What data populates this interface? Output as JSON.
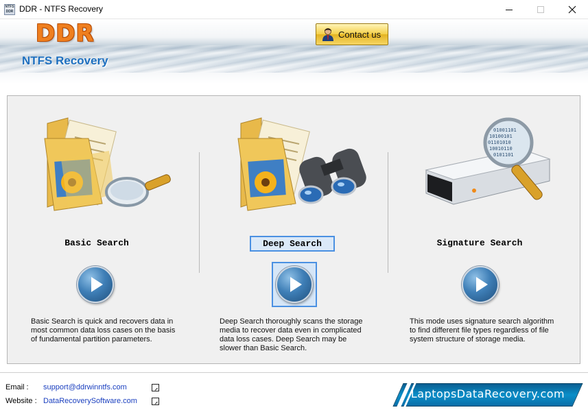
{
  "window": {
    "title": "DDR - NTFS Recovery",
    "icon_text": [
      "NTFS",
      "DDR"
    ]
  },
  "header": {
    "logo": "DDR",
    "subtitle": "NTFS Recovery",
    "contact_label": "Contact us"
  },
  "modes": [
    {
      "label": "Basic Search",
      "description": "Basic Search is quick and recovers data in most common data loss cases on the basis of fundamental partition parameters."
    },
    {
      "label": "Deep Search",
      "description": "Deep Search thoroughly scans the storage media to recover data even in complicated data loss cases. Deep Search may be slower than Basic Search.",
      "selected": true
    },
    {
      "label": "Signature Search",
      "description": "This mode uses signature search algorithm to find different file types regardless of file system structure of storage media."
    }
  ],
  "footer": {
    "email_label": "Email :",
    "email": "support@ddrwinntfs.com",
    "website_label": "Website :",
    "website": "DataRecoverySoftware.com",
    "brand": "LaptopsDataRecovery.com"
  },
  "colors": {
    "accent": "#1d6fbf",
    "logo": "#ef7f1f",
    "selection": "#4a90e2",
    "brand": "#0a8fc9"
  }
}
